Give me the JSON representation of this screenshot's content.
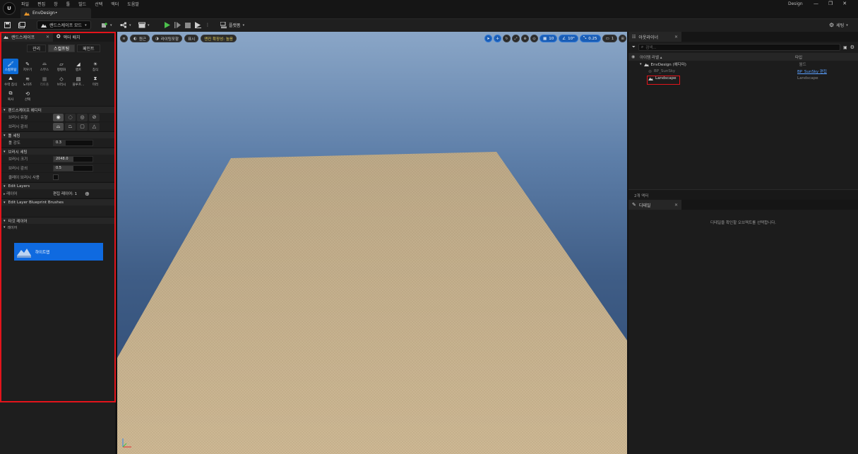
{
  "titlebar": {
    "logo": "U",
    "menu": [
      "파일",
      "편집",
      "창",
      "툴",
      "빌드",
      "선택",
      "액터",
      "도움말"
    ],
    "doc_tab": "EnvDesign•",
    "project": "Design",
    "win_controls": [
      "—",
      "❐",
      "✕"
    ]
  },
  "toolbar": {
    "mode_label": "랜드스케이프 모드",
    "platforms_label": "플랫폼",
    "settings_label": "세팅"
  },
  "left_panel": {
    "tabs": [
      "랜드스케이프",
      "액터 배치"
    ],
    "mode_tabs": [
      "관리",
      "스컬프팅",
      "페인트"
    ],
    "active_mode": "스컬프팅",
    "tools_row1": [
      "스컬프팅",
      "지우기",
      "스무스",
      "평평화",
      "램프",
      "침식"
    ],
    "tools_row2": [
      "수력 침식",
      "노이즈",
      "리토폴",
      "브러시",
      "블루프...",
      "미러"
    ],
    "tools_row3": [
      "복사",
      "선택"
    ],
    "sections": {
      "editor": "랜드스케이프 에디터",
      "brush_type": "브러시 유형",
      "brush_falloff": "브러시 감쇠",
      "tool_settings": "툴 세팅",
      "tool_strength": "툴 강도",
      "tool_strength_value": "0.3",
      "brush_settings": "브러시 세팅",
      "brush_size": "브러시 크기",
      "brush_size_value": "2048.0",
      "brush_falloff_value_label": "브러시 감쇠",
      "brush_falloff_value": "0.5",
      "clay_brush": "클레이 브러시 사용",
      "edit_layers": "Edit Layers",
      "layers": "레이어",
      "edit_layer_count": "편집 레이어: 1",
      "edit_layer_bp": "Edit Layer Blueprint Brushes",
      "target_layers": "타깃 레이어",
      "target_sub": "레이어",
      "heightmap": "하이트맵"
    },
    "tool_strength_fill": 0.3,
    "brush_size_fill": 0.5,
    "falloff_fill": 0.5
  },
  "viewport": {
    "left_buttons": [
      "원근",
      "라이팅포함",
      "표시"
    ],
    "edit_mode_badge": "엔진 확장성: 높음",
    "right_values": [
      "10",
      "10°",
      "0.25",
      "1"
    ]
  },
  "outliner": {
    "tab": "아웃라이너",
    "search_placeholder": "검색...",
    "col_label": "아이템 라벨 ▴",
    "col_type": "타입",
    "rows": [
      {
        "label": "EnvDesign (에디터)",
        "type": "월드"
      },
      {
        "label": "BP_SunSky",
        "type": "BP_SunSky 편집"
      },
      {
        "label": "Landscape",
        "type": "Landscape"
      }
    ],
    "count": "2개 액터"
  },
  "details": {
    "tab": "디테일",
    "empty_msg": "디테일을 확인할 오브젝트를 선택합니다."
  },
  "colors": {
    "accent": "#0d6bd6",
    "highlight": "#e3141b",
    "landscape": "#cdb894"
  }
}
